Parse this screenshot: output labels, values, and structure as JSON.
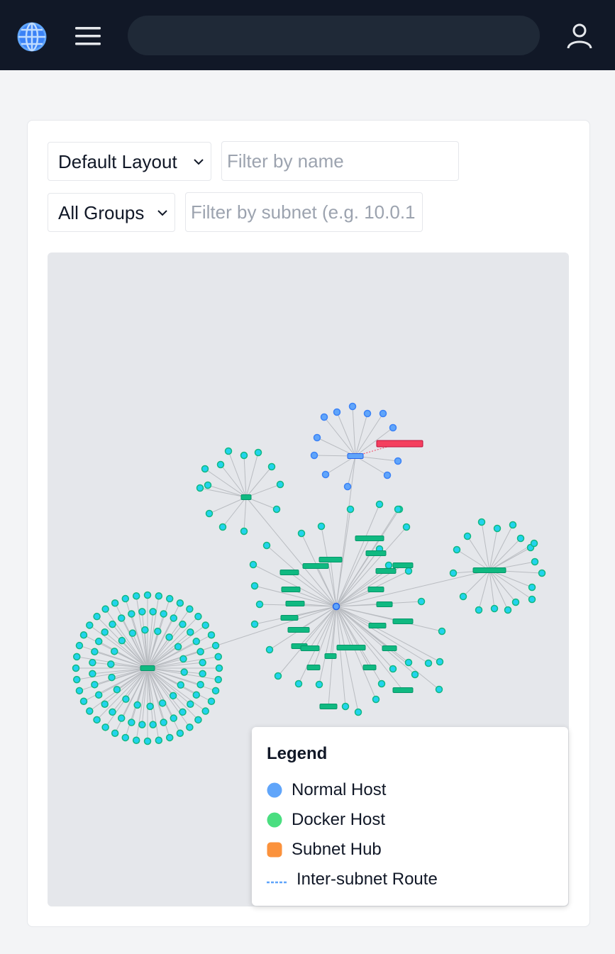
{
  "navbar": {
    "logo_icon": "globe-icon",
    "menu_icon": "hamburger-menu-icon",
    "search_placeholder": "",
    "user_icon": "user-icon"
  },
  "filters": {
    "layout_select": "Default Layout",
    "name_filter_placeholder": "Filter by name",
    "group_select": "All Groups",
    "subnet_filter_placeholder": "Filter by subnet (e.g. 10.0.1"
  },
  "legend": {
    "title": "Legend",
    "items": [
      {
        "label": "Normal Host",
        "color": "#60a5fa",
        "icon": "circle"
      },
      {
        "label": "Docker Host",
        "color": "#4ade80",
        "icon": "circle"
      },
      {
        "label": "Subnet Hub",
        "color": "#fb923c",
        "icon": "rounded-square"
      },
      {
        "label": "Inter-subnet Route",
        "color": "#60a5fa",
        "icon": "dashed-line"
      }
    ]
  },
  "colors": {
    "navbar_bg": "#111827",
    "graph_bg": "#e5e7eb",
    "host_node": "#60a5fa",
    "docker_node": "#22d3ee",
    "docker_hub": "#10b981",
    "alert_node": "#f43f5e",
    "edge": "#b9bcc1"
  }
}
